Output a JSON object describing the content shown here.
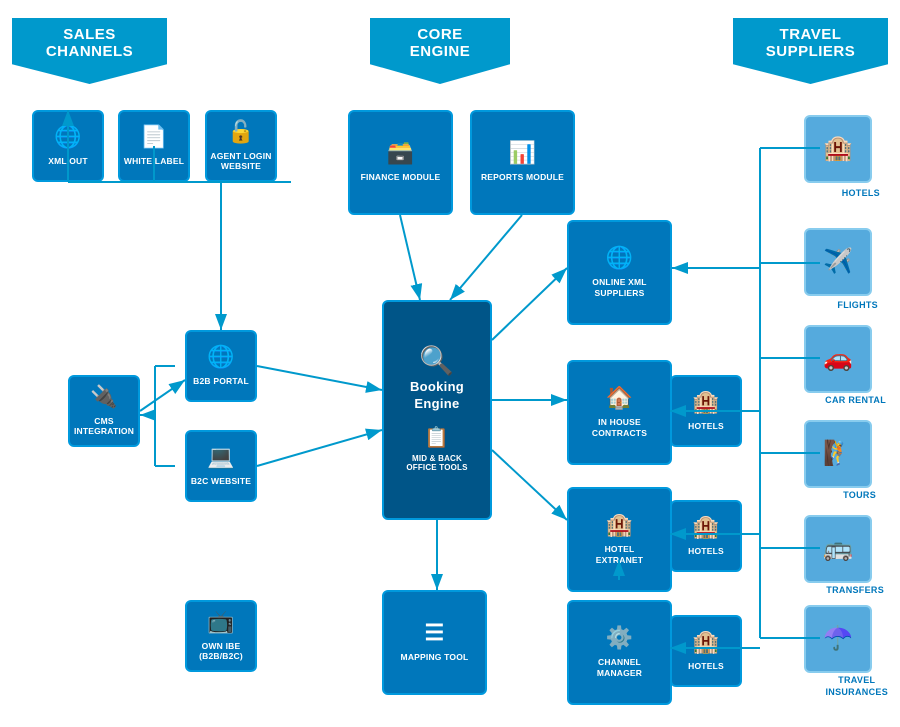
{
  "banners": {
    "sales": "SALES CHANNELS",
    "core": "CORE ENGINE",
    "travel": "TRAVEL SUPPLIERS"
  },
  "sales_channel_items": [
    {
      "id": "xml-out",
      "label": "XML OUT",
      "icon": "🌐"
    },
    {
      "id": "white-label",
      "label": "WHITE LABEL",
      "icon": "📄"
    },
    {
      "id": "agent-login",
      "label": "AGENT LOGIN\nWEBSITE",
      "icon": "🔓"
    },
    {
      "id": "b2b-portal",
      "label": "B2B PORTAL",
      "icon": "🌐"
    },
    {
      "id": "b2c-website",
      "label": "B2C WEBSITE",
      "icon": "💻"
    },
    {
      "id": "cms-integration",
      "label": "CMS\nINTEGRATION",
      "icon": "🔌"
    },
    {
      "id": "own-ibe",
      "label": "OWN IBE\n(B2B/B2C)",
      "icon": "📺"
    }
  ],
  "core_items": [
    {
      "id": "finance-module",
      "label": "FINANCE MODULE",
      "icon": "🗃️"
    },
    {
      "id": "reports-module",
      "label": "REPORTS MODULE",
      "icon": "📊"
    },
    {
      "id": "booking-engine",
      "label": "Booking Engine",
      "icon": "🔍"
    },
    {
      "id": "mid-back-office",
      "label": "MID & BACK OFFICE TOOLS",
      "icon": "📋"
    },
    {
      "id": "mapping-tool",
      "label": "MAPPING TOOL",
      "icon": "☰"
    }
  ],
  "supplier_connectors": [
    {
      "id": "online-xml",
      "label": "ONLINE XML\nSUPPLIERS",
      "icon": "🌐"
    },
    {
      "id": "in-house-contracts",
      "label": "IN HOUSE\nCONTRACTS",
      "icon": "🏠"
    },
    {
      "id": "hotel-extranet",
      "label": "HOTEL\nEXTRANET",
      "icon": "🏨"
    },
    {
      "id": "channel-manager",
      "label": "CHANNEL\nMANAGER",
      "icon": "⚙️"
    }
  ],
  "travel_suppliers": [
    {
      "id": "hotels",
      "label": "HOTELS",
      "icon": "🏨"
    },
    {
      "id": "flights",
      "label": "FLIGHTS",
      "icon": "✈️"
    },
    {
      "id": "car-rental",
      "label": "CAR RENTAL",
      "icon": "🚗"
    },
    {
      "id": "tours",
      "label": "TOURS",
      "icon": "🧗"
    },
    {
      "id": "transfers",
      "label": "TRANSFERS",
      "icon": "🚌"
    },
    {
      "id": "travel-insurances",
      "label": "TRAVEL\nINSURANCES",
      "icon": "☂️"
    }
  ],
  "hotels_connector_labels": [
    "HOTELS",
    "HOTELS",
    "HOTELS"
  ]
}
